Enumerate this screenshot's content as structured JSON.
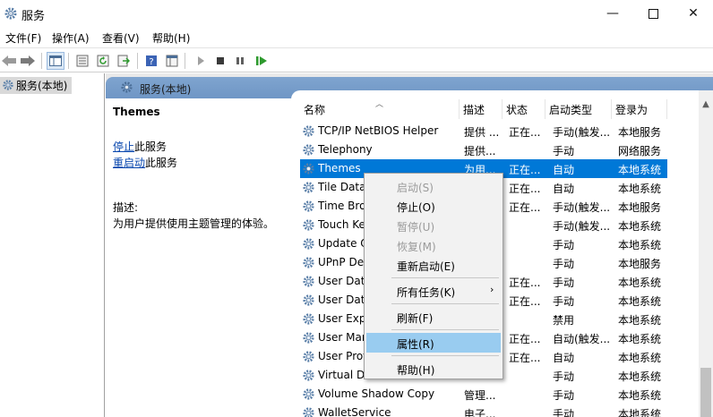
{
  "window": {
    "title": "服务"
  },
  "menu": [
    "文件(F)",
    "操作(A)",
    "查看(V)",
    "帮助(H)"
  ],
  "toolbar": {
    "icons": [
      "back-arrow-icon",
      "forward-arrow-icon",
      "show-tree-icon",
      "properties-icon",
      "refresh-icon",
      "export-list-icon",
      "help-icon",
      "console-icon",
      "start-icon",
      "stop-icon",
      "pause-icon",
      "restart-icon"
    ]
  },
  "tree": {
    "root": "服务(本地)"
  },
  "panel": {
    "header": "服务(本地)"
  },
  "description": {
    "title": "Themes",
    "stop_link": "停止",
    "stop_suffix": "此服务",
    "restart_link": "重启动",
    "restart_suffix": "此服务",
    "label": "描述:",
    "text": "为用户提供使用主题管理的体验。"
  },
  "columns": [
    "名称",
    "描述",
    "状态",
    "启动类型",
    "登录为"
  ],
  "rows": [
    {
      "name": "TCP/IP NetBIOS Helper",
      "desc": "提供 ...",
      "status": "正在...",
      "startup": "手动(触发...",
      "logon": "本地服务"
    },
    {
      "name": "Telephony",
      "desc": "提供...",
      "status": "",
      "startup": "手动",
      "logon": "网络服务"
    },
    {
      "name": "Themes",
      "desc": "为用...",
      "status": "正在...",
      "startup": "自动",
      "logon": "本地系统"
    },
    {
      "name": "Tile Data",
      "desc": "",
      "status": "正在...",
      "startup": "自动",
      "logon": "本地系统"
    },
    {
      "name": "Time Bro",
      "desc": "",
      "status": "正在...",
      "startup": "手动(触发...",
      "logon": "本地服务"
    },
    {
      "name": "Touch Ke",
      "desc": "",
      "status": "",
      "startup": "手动(触发...",
      "logon": "本地系统"
    },
    {
      "name": "Update O",
      "desc": "",
      "status": "",
      "startup": "手动",
      "logon": "本地系统"
    },
    {
      "name": "UPnP Dev",
      "desc": "",
      "status": "",
      "startup": "手动",
      "logon": "本地服务"
    },
    {
      "name": "User Data",
      "desc": "",
      "status": "正在...",
      "startup": "手动",
      "logon": "本地系统"
    },
    {
      "name": "User Data",
      "desc": "",
      "status": "正在...",
      "startup": "手动",
      "logon": "本地系统"
    },
    {
      "name": "User Exp",
      "desc": "",
      "status": "",
      "startup": "禁用",
      "logon": "本地系统"
    },
    {
      "name": "User Mar",
      "desc": "",
      "status": "正在...",
      "startup": "自动(触发...",
      "logon": "本地系统"
    },
    {
      "name": "User Prof",
      "desc": "",
      "status": "正在...",
      "startup": "自动",
      "logon": "本地系统"
    },
    {
      "name": "Virtual Di",
      "desc": "",
      "status": "",
      "startup": "手动",
      "logon": "本地系统"
    },
    {
      "name": "Volume Shadow Copy",
      "desc": "管理...",
      "status": "",
      "startup": "手动",
      "logon": "本地系统"
    },
    {
      "name": "WalletService",
      "desc": "电子...",
      "status": "",
      "startup": "手动",
      "logon": "本地系统"
    }
  ],
  "context_menu": [
    {
      "label": "启动(S)",
      "state": "disabled"
    },
    {
      "label": "停止(O)",
      "state": "enabled"
    },
    {
      "label": "暂停(U)",
      "state": "disabled"
    },
    {
      "label": "恢复(M)",
      "state": "disabled"
    },
    {
      "label": "重新启动(E)",
      "state": "enabled"
    },
    {
      "label": "所有任务(K)",
      "state": "enabled",
      "submenu": true
    },
    {
      "label": "刷新(F)",
      "state": "enabled"
    },
    {
      "label": "属性(R)",
      "state": "highlighted"
    },
    {
      "label": "帮助(H)",
      "state": "enabled"
    }
  ],
  "colors": {
    "selection": "#0078d7",
    "menu_highlight": "#99ccf0",
    "panel_header": "#7fa4cf",
    "link": "#0645ad"
  }
}
